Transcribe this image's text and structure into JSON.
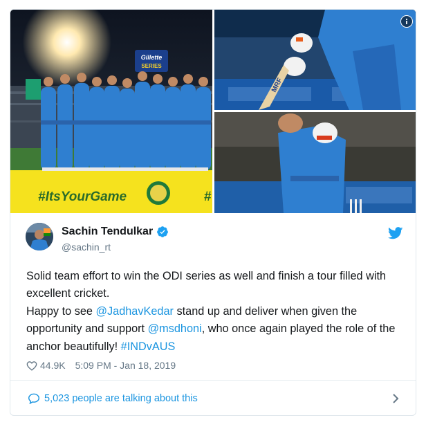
{
  "media": {
    "ad_board_brand": "Gillette",
    "ad_board_sub": "SERIES",
    "hashtag_banner": "#ItsYourGame",
    "banner_edge_char": "#",
    "bat_brand": "MRF"
  },
  "tweet": {
    "author_name": "Sachin Tendulkar",
    "author_handle": "@sachin_rt",
    "text_line1": "Solid team effort to win the ODI series as well and finish a tour filled with excellent cricket.",
    "text_p2_before": "Happy to see ",
    "mention1": "@JadhavKedar",
    "text_p2_middle": " stand up and deliver when given the opportunity and support ",
    "mention2": "@msdhoni",
    "text_p2_after": ", who once again played the role of the anchor beautifully! ",
    "hashtag": "#INDvAUS",
    "likes": "44.9K",
    "timestamp": "5:09 PM - Jan 18, 2019",
    "talking": "5,023 people are talking about this"
  },
  "colors": {
    "link": "#1b95e0",
    "secondary_text": "#657786",
    "primary_text": "#14171a",
    "jersey_blue": "#2f7fd0"
  },
  "icons": [
    "info-icon",
    "verified-badge-icon",
    "twitter-bird-icon",
    "heart-icon",
    "reply-bubble-icon",
    "chevron-right-icon"
  ]
}
